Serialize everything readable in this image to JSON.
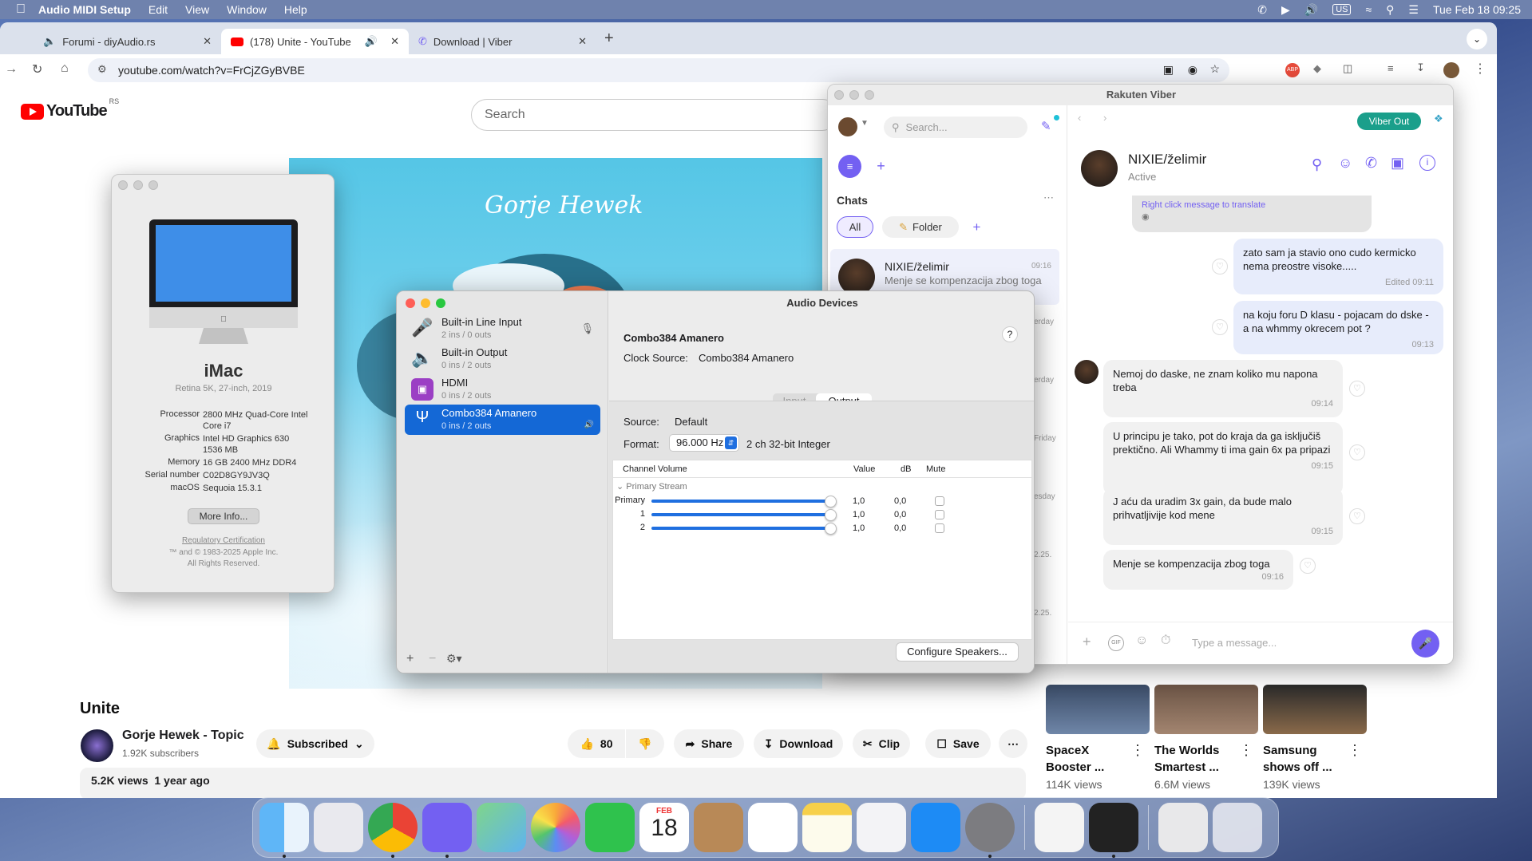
{
  "menubar": {
    "app_name": "Audio MIDI Setup",
    "items": [
      "Edit",
      "View",
      "Window",
      "Help"
    ],
    "input_source": "US",
    "datetime": "Tue Feb 18  09:25"
  },
  "browser": {
    "tabs": [
      {
        "title": "Forumi - diyAudio.rs"
      },
      {
        "title": "(178) Unite - YouTube"
      },
      {
        "title": "Download | Viber"
      }
    ],
    "url": "youtube.com/watch?v=FrCjZGyBVBE"
  },
  "youtube": {
    "logo_text": "YouTube",
    "region": "RS",
    "search_placeholder": "Search",
    "video_title": "Unite",
    "channel_name": "Gorje Hewek - Topic",
    "subscribers": "1.92K subscribers",
    "subscribed_label": "Subscribed",
    "like_count": "80",
    "share_label": "Share",
    "download_label": "Download",
    "clip_label": "Clip",
    "save_label": "Save",
    "stats": "5.2K views  1 year ago",
    "artwork_text": "Gorje Hewek",
    "recommendations": [
      {
        "title": "SpaceX Booster ...",
        "views": "114K views"
      },
      {
        "title": "The Worlds Smartest ...",
        "views": "6.6M views"
      },
      {
        "title": "Samsung shows off ...",
        "views": "139K views"
      }
    ]
  },
  "about_mac": {
    "model": "iMac",
    "subtitle": "Retina 5K, 27-inch, 2019",
    "specs": [
      {
        "label": "Processor",
        "value": "2800 MHz Quad-Core Intel Core i7"
      },
      {
        "label": "Graphics",
        "value": "Intel HD Graphics 630 1536 MB"
      },
      {
        "label": "Memory",
        "value": "16 GB 2400 MHz DDR4"
      },
      {
        "label": "Serial number",
        "value": "C02D8GY9JV3Q"
      },
      {
        "label": "macOS",
        "value": "Sequoia 15.3.1"
      }
    ],
    "more_info_label": "More Info...",
    "regulatory": "Regulatory Certification",
    "copyright1": "™ and © 1983-2025 Apple Inc.",
    "copyright2": "All Rights Reserved."
  },
  "viber": {
    "window_title": "Rakuten Viber",
    "search_placeholder": "Search...",
    "chats_label": "Chats",
    "filter_all": "All",
    "filter_folder": "Folder",
    "chat_item": {
      "name": "NIXIE/želimir",
      "time": "09:16",
      "preview": "Menje se kompenzacija zbog toga"
    },
    "list_dates": [
      "erday",
      "erday",
      "Friday",
      "esday",
      "2.25.",
      "2.25."
    ],
    "viber_out_label": "Viber Out",
    "contact_name": "NIXIE/želimir",
    "contact_status": "Active",
    "translate_hint": "Right click message to translate",
    "messages": [
      {
        "dir": "out",
        "text": "zato sam ja stavio ono cudo kermicko nema preostre visoke.....",
        "time": "Edited 09:11"
      },
      {
        "dir": "out",
        "text": "na koju foru D klasu - pojacam do dske - a na whmmy okrecem pot ?",
        "time": "09:13"
      },
      {
        "dir": "in",
        "text": "Nemoj do daske, ne znam koliko mu napona treba",
        "time": "09:14"
      },
      {
        "dir": "in",
        "text": "U principu je tako, pot do kraja da ga isključiš prektično. Ali Whammy ti ima gain 6x pa pripazi",
        "time": "09:15"
      },
      {
        "dir": "in",
        "text": "J aću da uradim 3x gain, da bude malo prihvatljivije kod mene",
        "time": "09:15"
      },
      {
        "dir": "in",
        "text": "Menje se kompenzacija zbog toga",
        "time": "09:16"
      }
    ],
    "compose_placeholder": "Type a message..."
  },
  "audio": {
    "window_title": "Audio Devices",
    "devices": [
      {
        "name": "Built-in Line Input",
        "io": "2 ins / 0 outs"
      },
      {
        "name": "Built-in Output",
        "io": "0 ins / 2 outs"
      },
      {
        "name": "HDMI",
        "io": "0 ins / 2 outs"
      },
      {
        "name": "Combo384 Amanero",
        "io": "0 ins / 2 outs"
      }
    ],
    "selected_name": "Combo384 Amanero",
    "clock_label": "Clock Source:",
    "clock_value": "Combo384 Amanero",
    "help": "?",
    "seg_input": "Input",
    "seg_output": "Output",
    "source_label": "Source:",
    "source_value": "Default",
    "format_label": "Format:",
    "format_rate": "96.000 Hz",
    "format_desc": "2 ch 32-bit Integer",
    "col_channel": "Channel Volume",
    "col_value": "Value",
    "col_db": "dB",
    "col_mute": "Mute",
    "stream_label": "Primary Stream",
    "channels": [
      {
        "name": "Primary",
        "level": 1.0,
        "value": "1,0",
        "db": "0,0"
      },
      {
        "name": "1",
        "level": 1.0,
        "value": "1,0",
        "db": "0,0"
      },
      {
        "name": "2",
        "level": 1.0,
        "value": "1,0",
        "db": "0,0"
      }
    ],
    "configure_label": "Configure Speakers..."
  },
  "dock": {
    "calendar_month": "FEB",
    "calendar_day": "18"
  }
}
